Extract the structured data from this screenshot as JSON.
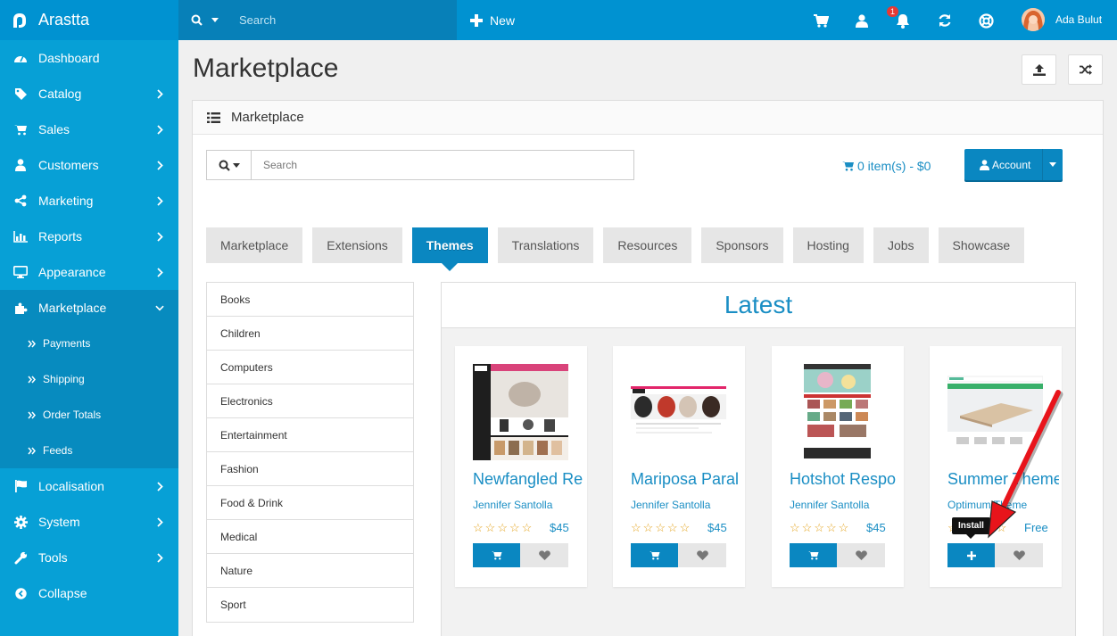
{
  "app": {
    "brand": "Arastta"
  },
  "topbar": {
    "search_placeholder": "Search",
    "new_label": "New",
    "notification_count": "1",
    "user_name": "Ada Bulut",
    "colors": {
      "topbar": "#0092d1",
      "search_bg": "#0780b8"
    },
    "icons": [
      "cart-icon",
      "user-icon",
      "bell-icon",
      "refresh-icon",
      "lifebuoy-icon"
    ]
  },
  "sidebar": {
    "items": [
      {
        "label": "Dashboard",
        "icon": "dashboard-icon",
        "has_children": false
      },
      {
        "label": "Catalog",
        "icon": "tag-icon",
        "has_children": true
      },
      {
        "label": "Sales",
        "icon": "cart-icon",
        "has_children": true
      },
      {
        "label": "Customers",
        "icon": "user-icon",
        "has_children": true
      },
      {
        "label": "Marketing",
        "icon": "share-icon",
        "has_children": true
      },
      {
        "label": "Reports",
        "icon": "bar-chart-icon",
        "has_children": true
      },
      {
        "label": "Appearance",
        "icon": "desktop-icon",
        "has_children": true
      },
      {
        "label": "Marketplace",
        "icon": "puzzle-icon",
        "has_children": true,
        "active": true
      }
    ],
    "subitems": [
      {
        "label": "Payments"
      },
      {
        "label": "Shipping"
      },
      {
        "label": "Order Totals"
      },
      {
        "label": "Feeds"
      }
    ],
    "items_after": [
      {
        "label": "Localisation",
        "icon": "flag-icon",
        "has_children": true
      },
      {
        "label": "System",
        "icon": "cog-icon",
        "has_children": true
      },
      {
        "label": "Tools",
        "icon": "wrench-icon",
        "has_children": true
      },
      {
        "label": "Collapse",
        "icon": "collapse-icon",
        "has_children": false
      }
    ],
    "colors": {
      "bg": "#07a0d6",
      "active": "#078bbf"
    }
  },
  "page": {
    "title": "Marketplace",
    "header_buttons": [
      "upload-icon",
      "shuffle-icon"
    ]
  },
  "panel": {
    "heading": "Marketplace",
    "search_placeholder": "Search",
    "cart_summary": "0 item(s) - $0",
    "account_label": "Account",
    "tabs": [
      {
        "label": "Marketplace"
      },
      {
        "label": "Extensions"
      },
      {
        "label": "Themes",
        "active": true
      },
      {
        "label": "Translations"
      },
      {
        "label": "Resources"
      },
      {
        "label": "Sponsors"
      },
      {
        "label": "Hosting"
      },
      {
        "label": "Jobs"
      },
      {
        "label": "Showcase"
      }
    ],
    "categories": [
      "Books",
      "Children",
      "Computers",
      "Electronics",
      "Entertainment",
      "Fashion",
      "Food & Drink",
      "Medical",
      "Nature",
      "Sport"
    ],
    "latest": {
      "heading": "Latest",
      "products": [
        {
          "title": "Newfangled Re",
          "author": "Jennifer Santolla",
          "price": "$45",
          "rating": 0,
          "action": "cart"
        },
        {
          "title": "Mariposa Paral",
          "author": "Jennifer Santolla",
          "price": "$45",
          "rating": 0,
          "action": "cart"
        },
        {
          "title": "Hotshot Respo",
          "author": "Jennifer Santolla",
          "price": "$45",
          "rating": 0,
          "action": "cart"
        },
        {
          "title": "Summer Theme",
          "author": "Optimum Theme",
          "price": "Free",
          "rating": 0,
          "action": "install"
        }
      ],
      "tooltip": "Install"
    },
    "colors": {
      "accent": "#0a87c1",
      "link": "#1a8ec4",
      "star": "#e3a21a",
      "annotation_arrow": "#e8141b"
    }
  }
}
